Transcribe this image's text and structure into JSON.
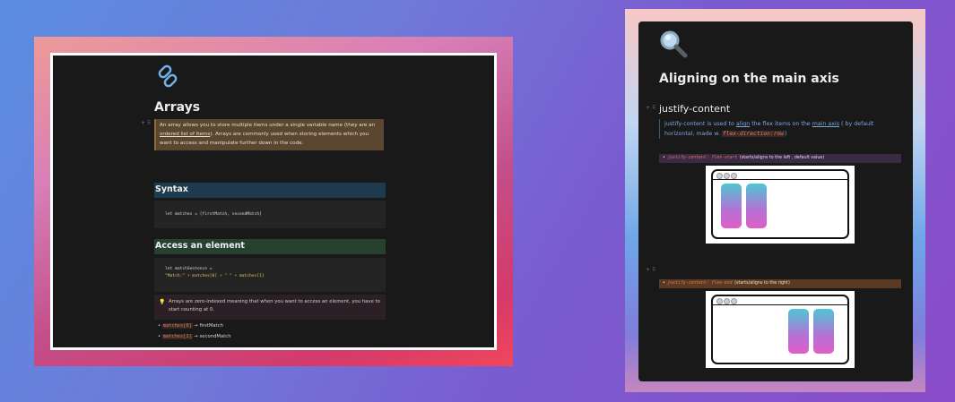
{
  "left_page": {
    "title": "Arrays",
    "intro": {
      "part1": "An array allows you to store multiple items under a single variable name (they are  an ",
      "link": "ordered list of items",
      "part2": ").  Arrays are commonly used when storing elements which you want to access and manipulate further down in the code."
    },
    "syntax": {
      "heading": "Syntax",
      "code": "let matches = [firstMatch, secondMatch]"
    },
    "access": {
      "heading": "Access an element",
      "code_line1": "let matchSentence =",
      "code_line2": "\"Match:\" + matches[0] + \" \" + matches[1]"
    },
    "tip": "Arrays are zero-indexed meaning that when you want to access an element, you have to start counting at 0.",
    "bullets": [
      {
        "code": "matches[0]",
        "text": "→ firstMatch"
      },
      {
        "code": "matches[1]",
        "text": "→ secondMatch"
      }
    ]
  },
  "right_page": {
    "title": "Aligning on the main axis",
    "subheading": "justify-content",
    "desc": {
      "p1": "justify-content is used to ",
      "link1": "align",
      "p2": " the flex items on the ",
      "link2": "main axis",
      "p3": " ( by default horizontal, made w.  ",
      "code": "flex-direction:row",
      "p4": ")"
    },
    "flex_start": {
      "code": "justify-content: flex-start",
      "text": "(starts/aligns to the left , default value)"
    },
    "flex_end": {
      "code": "justify-content: flex-end",
      "text": "(starts/aligns to the right)"
    }
  },
  "colors": {
    "callout_brown": "#5b4730",
    "syntax_band": "#1e3a4e",
    "access_band": "#27402f",
    "flex_start_band": "#3b2a44",
    "flex_end_band": "#5a3a22",
    "link": "#7aa8d8"
  }
}
